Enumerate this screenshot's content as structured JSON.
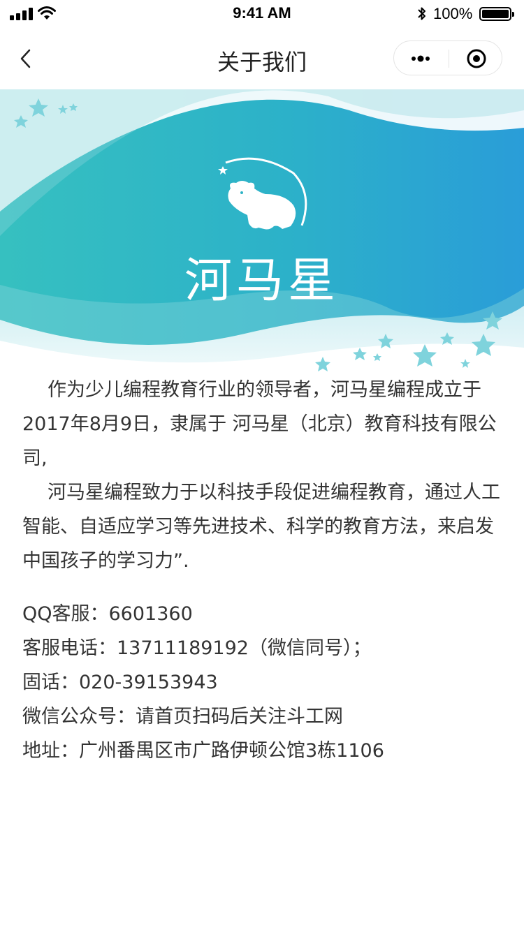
{
  "status_bar": {
    "time": "9:41 AM",
    "battery": "100%"
  },
  "nav": {
    "title": "关于我们",
    "icons": {
      "back": "chevron-left-icon",
      "more": "more-dots-icon",
      "close": "target-close-icon"
    }
  },
  "banner": {
    "brand_name": "河马星",
    "colors": {
      "teal": "#2fb7bf",
      "blue": "#2a9ed8",
      "light": "#bfe8ee"
    }
  },
  "about": {
    "paragraph_1": "作为少儿编程教育行业的领导者，河马星编程成立于2017年8月9日，隶属于 河马星（北京）教育科技有限公司,",
    "paragraph_2": "河马星编程致力于以科技手段促进编程教育，通过人工智能、自适应学习等先进技术、科学的教育方法，来启发中国孩子的学习力”."
  },
  "contact": {
    "qq": "QQ客服：6601360",
    "phone": "客服电话：13711189192（微信同号）；",
    "landline": "固话：020-39153943",
    "wechat": "微信公众号：请首页扫码后关注斗工网",
    "address": "地址：广州番禺区市广路伊顿公馆3栋1106"
  }
}
